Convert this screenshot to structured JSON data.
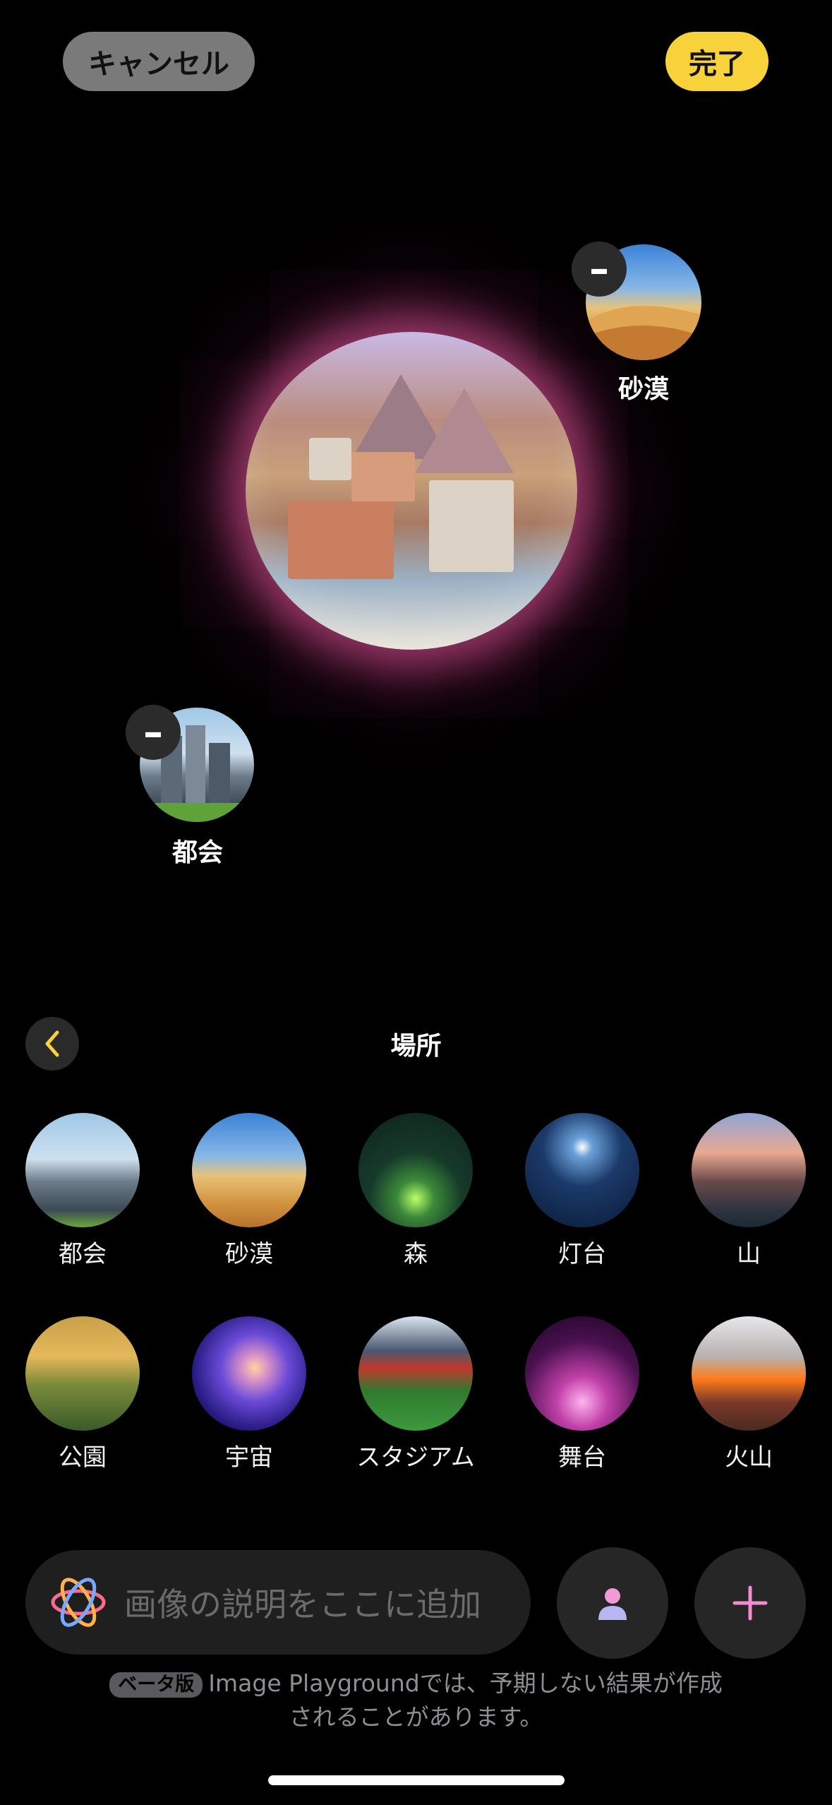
{
  "header": {
    "cancel_label": "キャンセル",
    "done_label": "完了",
    "done_color": "#f8d23a"
  },
  "canvas": {
    "selected_concepts": [
      {
        "label": "砂漠",
        "icon": "desert-thumbnail"
      },
      {
        "label": "都会",
        "icon": "city-thumbnail"
      }
    ],
    "preview": "generated-image-preview"
  },
  "category": {
    "title": "場所",
    "back_icon": "chevron-left-icon",
    "items": [
      {
        "label": "都会",
        "icon": "city-thumbnail"
      },
      {
        "label": "砂漠",
        "icon": "desert-thumbnail"
      },
      {
        "label": "森",
        "icon": "forest-thumbnail"
      },
      {
        "label": "灯台",
        "icon": "lighthouse-thumbnail"
      },
      {
        "label": "山",
        "icon": "mountain-thumbnail"
      },
      {
        "label": "公園",
        "icon": "park-thumbnail"
      },
      {
        "label": "宇宙",
        "icon": "space-thumbnail"
      },
      {
        "label": "スタジアム",
        "icon": "stadium-thumbnail"
      },
      {
        "label": "舞台",
        "icon": "stage-thumbnail"
      },
      {
        "label": "火山",
        "icon": "volcano-thumbnail"
      }
    ]
  },
  "prompt": {
    "placeholder": "画像の説明をここに追加",
    "person_button_icon": "person-icon",
    "add_button_icon": "plus-icon"
  },
  "footer": {
    "beta_badge": "ベータ版",
    "note_line1": "Image Playgroundでは、予期しない結果が作成",
    "note_line2": "されることがあります。"
  }
}
